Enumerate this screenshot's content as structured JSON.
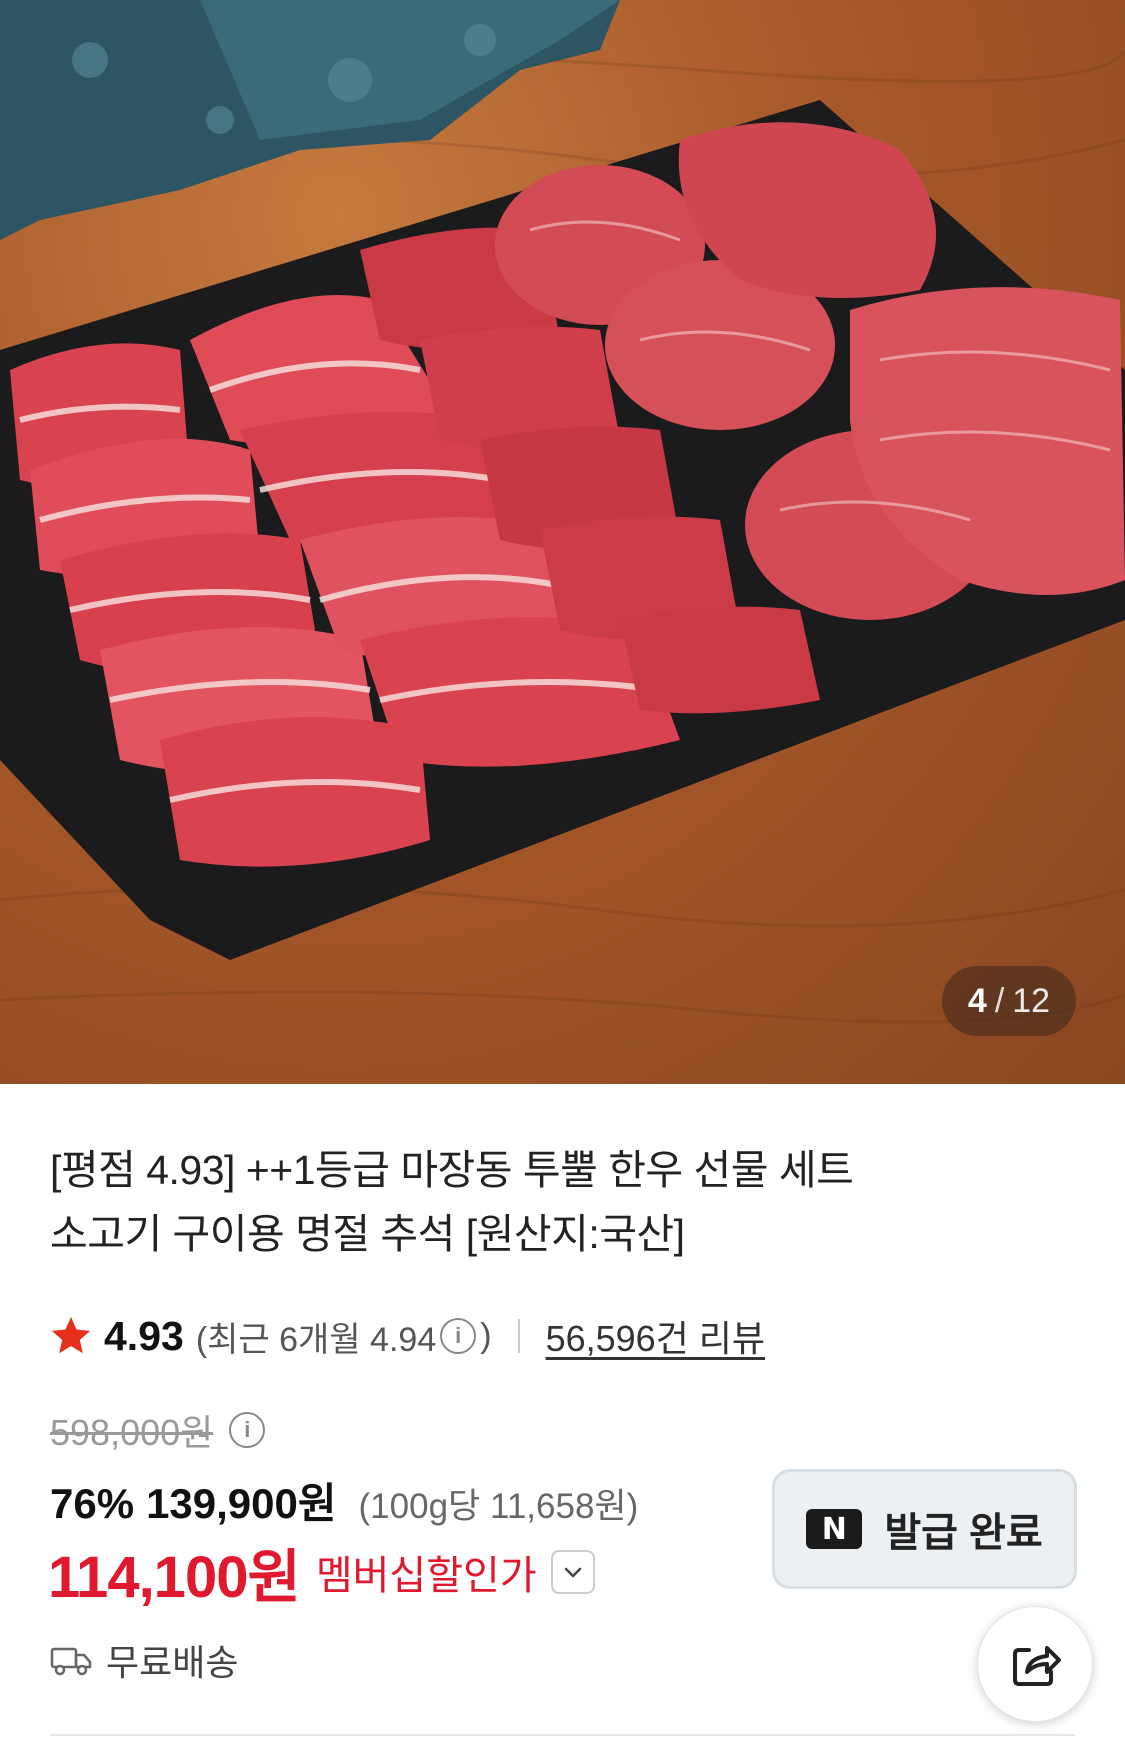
{
  "gallery": {
    "current": "4",
    "separator": "/",
    "total": "12"
  },
  "product": {
    "title_line1": "[평점 4.93] ++1등급 마장동 투뿔 한우 선물 세트",
    "title_line2": "소고기 구이용 명절 추석 [원산지:국산]"
  },
  "rating": {
    "score": "4.93",
    "recent_open": "(최근 6개월 4.94",
    "recent_close": ")",
    "reviews": "56,596건 리뷰"
  },
  "price": {
    "original": "598,000원",
    "discount": "76%",
    "sale": "139,900원",
    "unit": "(100g당 11,658원)",
    "member": "114,100원",
    "member_label": "멤버십할인가"
  },
  "coupon": {
    "badge": "N",
    "label": "발급 완료"
  },
  "shipping": {
    "label": "무료배송"
  },
  "colors": {
    "accent_red": "#e0192f",
    "star": "#e8301e"
  },
  "icons": {
    "star": "star-icon",
    "info": "info-icon",
    "chevron": "chevron-down-icon",
    "truck": "truck-icon",
    "share": "share-icon"
  }
}
